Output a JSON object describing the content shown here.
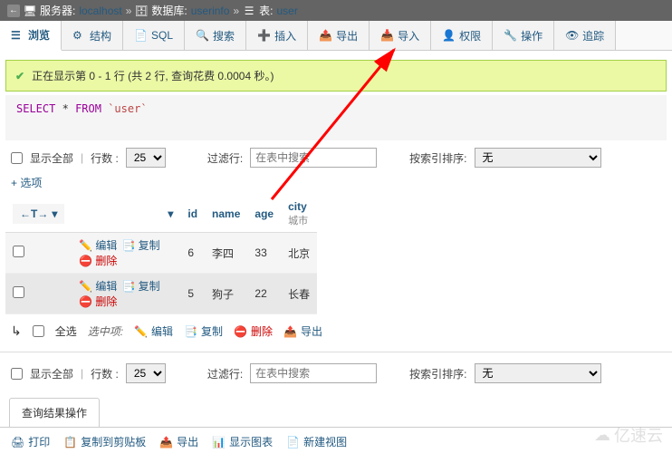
{
  "breadcrumb": {
    "server_label": "服务器:",
    "server_value": "localhost",
    "db_label": "数据库:",
    "db_value": "userinfo",
    "table_label": "表:",
    "table_value": "user"
  },
  "tabs": {
    "browse": "浏览",
    "structure": "结构",
    "sql": "SQL",
    "search": "搜索",
    "insert": "插入",
    "export": "导出",
    "import": "导入",
    "privileges": "权限",
    "operations": "操作",
    "tracking": "追踪"
  },
  "status": {
    "text": "正在显示第 0 - 1 行 (共 2 行, 查询花费 0.0004 秒。)"
  },
  "sql": {
    "select": "SELECT",
    "star": "*",
    "from": "FROM",
    "table": "`user`"
  },
  "controls": {
    "show_all": "显示全部",
    "rows_label": "行数 :",
    "rows_value": "25",
    "filter_label": "过滤行:",
    "filter_placeholder": "在表中搜索",
    "sort_idx_label": "按索引排序:",
    "sort_idx_value": "无"
  },
  "options_toggle": "+ 选项",
  "table": {
    "sort_label": "←T→",
    "headers": {
      "id": "id",
      "name": "name",
      "age": "age",
      "city": "city",
      "city_sub": "城市"
    },
    "row_actions": {
      "edit": "编辑",
      "copy": "复制",
      "delete": "删除"
    },
    "rows": [
      {
        "id": "6",
        "name": "李四",
        "age": "33",
        "city": "北京"
      },
      {
        "id": "5",
        "name": "狗子",
        "age": "22",
        "city": "长春"
      }
    ]
  },
  "bulk": {
    "select_all": "全选",
    "with_selected": "选中项:",
    "edit": "编辑",
    "copy": "复制",
    "delete": "删除",
    "export": "导出"
  },
  "result_ops": {
    "tab": "查询结果操作"
  },
  "result_links": {
    "print": "打印",
    "copy_clip": "复制到剪贴板",
    "export": "导出",
    "chart": "显示图表",
    "new_view": "新建视图"
  },
  "watermark": "亿速云"
}
